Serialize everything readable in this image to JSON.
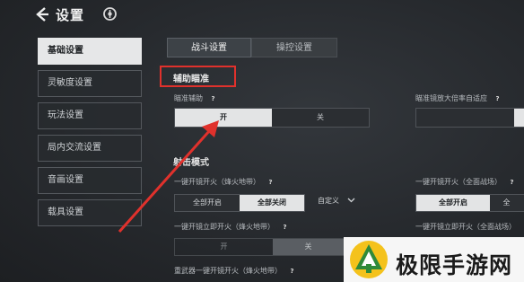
{
  "header": {
    "title": "设置",
    "back_icon": "chevron-left-icon",
    "logo_icon": "game-logo-icon"
  },
  "sidebar": {
    "items": [
      {
        "label": "基础设置",
        "active": true
      },
      {
        "label": "灵敏度设置",
        "active": false
      },
      {
        "label": "玩法设置",
        "active": false
      },
      {
        "label": "局内交流设置",
        "active": false
      },
      {
        "label": "音画设置",
        "active": false
      },
      {
        "label": "载具设置",
        "active": false
      }
    ]
  },
  "tabs": [
    {
      "label": "战斗设置",
      "active": true
    },
    {
      "label": "操控设置",
      "active": false
    }
  ],
  "aim_assist": {
    "heading": "辅助瞄准",
    "aim_assist_label": "瞄准辅助",
    "help_mark": "?",
    "on_label": "开",
    "off_label": "关",
    "scope_adapt_label": "瞄准镜放大倍率自适应"
  },
  "fire_mode": {
    "heading": "射击模式",
    "one_key_scope_fire_label": "一键开镜开火（烽火地带）",
    "options_all_on": "全部开启",
    "options_all_off": "全部关闭",
    "options_custom": "自定义",
    "one_key_scope_fire_full_label": "一键开镜开火（全面战场）",
    "one_key_scope_instant_label": "一键开镜立即开火（烽火地带）",
    "one_key_scope_instant_full_label": "一键开镜立即开火（全面战场）",
    "instant_on": "开",
    "instant_off": "关",
    "heavy_weapon_label": "重武器一键开镜开火（烽火地带）"
  },
  "right_edge": {
    "all_on": "全部开启",
    "all_partial": "全"
  },
  "watermark": {
    "text": "极限手游网"
  },
  "colors": {
    "highlight_red": "#e0312c",
    "active_bg": "#e3e4e5"
  }
}
